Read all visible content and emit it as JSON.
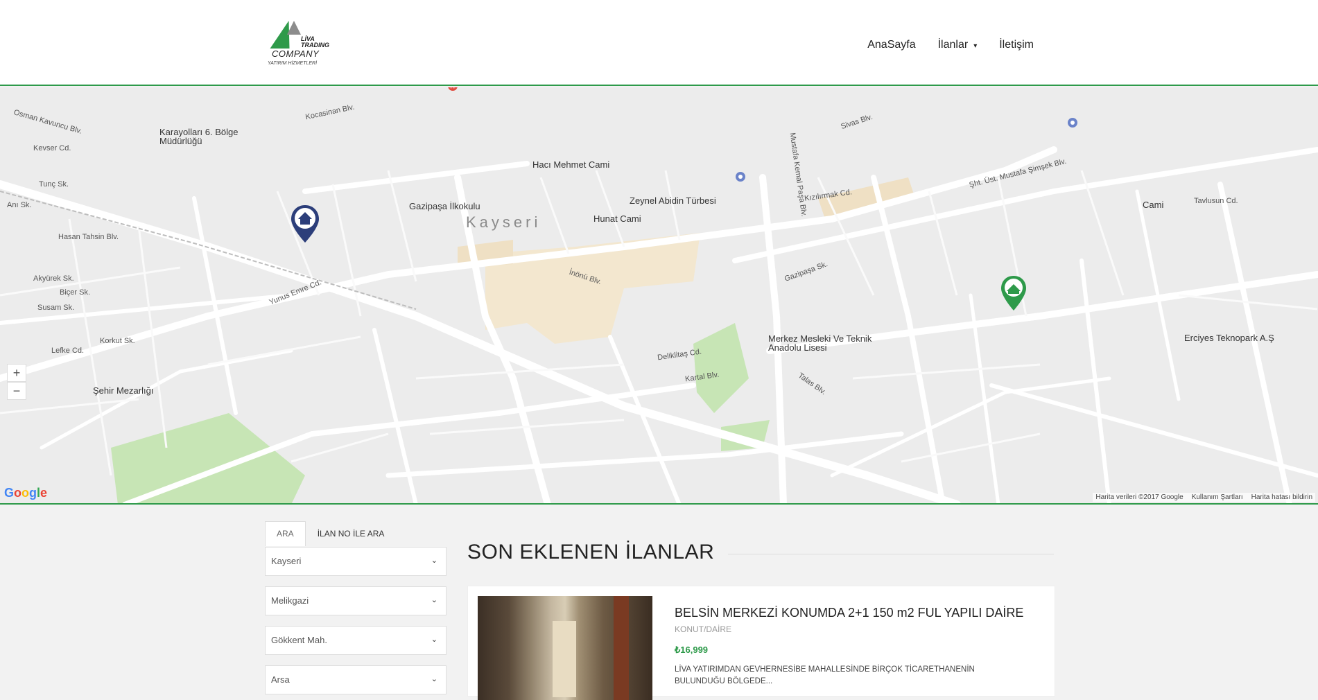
{
  "brand": {
    "line1": "LİVA",
    "line2": "TRADING",
    "name": "COMPANY",
    "tagline": "YATIRIM HİZMETLERİ"
  },
  "nav": {
    "home": "AnaSayfa",
    "listings": "İlanlar",
    "contact": "İletişim"
  },
  "map": {
    "city_label": "Kayseri",
    "labels": [
      "Kocasinan Blv.",
      "Osman Kavuncu Blv.",
      "Karayolları 6. Bölge Müdürlüğü",
      "Kevser Cd.",
      "Tunç Sk.",
      "Anı Sk.",
      "Hasan Tahsin Blv.",
      "Akyürek Sk.",
      "Biçer Sk.",
      "Susam Sk.",
      "Korkut Sk.",
      "Lefke Cd.",
      "Şehir Mezarlığı",
      "Gazipaşa İlkokulu",
      "Hacı Mehmet Cami",
      "Zeynel Abidin Türbesi",
      "Hunat Cami",
      "Merkez Mesleki Ve Teknik Anadolu Lisesi",
      "Cami",
      "Erciyes Teknopark A.Ş",
      "Sivas Blv.",
      "Mustafa Kemal Paşa Blv.",
      "Talas Blv.",
      "Kartal Blv.",
      "Gazipaşa Sk.",
      "Deliklitaş Cd.",
      "Şht. Üst. Mustafa Şimşek Blv.",
      "Kızılırmak Cd.",
      "Tavlusun Cd.",
      "Yunus Emre Cd.",
      "İnönü Blv."
    ],
    "zoom_in": "+",
    "zoom_out": "−",
    "google": "Google",
    "attribution": [
      "Harita verileri ©2017 Google",
      "Kullanım Şartları",
      "Harita hatası bildirin"
    ]
  },
  "search": {
    "tabs": [
      "ARA",
      "İLAN NO İLE ARA"
    ],
    "selects": [
      "Kayseri",
      "Melikgazi",
      "Gökkent Mah.",
      "Arsa"
    ]
  },
  "listings": {
    "section_title": "SON EKLENEN İLANLAR",
    "items": [
      {
        "title": "BELSİN MERKEZİ KONUMDA 2+1 150 m2 FUL YAPILI DAİRE",
        "category": "KONUT/DAİRE",
        "price": "₺16,999",
        "description": "LİVA YATIRIMDAN GEVHERNESİBE MAHALLESİNDE BİRÇOK TİCARETHANENİN BULUNDUĞU BÖLGEDE..."
      }
    ]
  },
  "colors": {
    "accent": "#2e9a4a",
    "marker_home": "#2c3e7a",
    "marker_green": "#2e9a4a"
  }
}
